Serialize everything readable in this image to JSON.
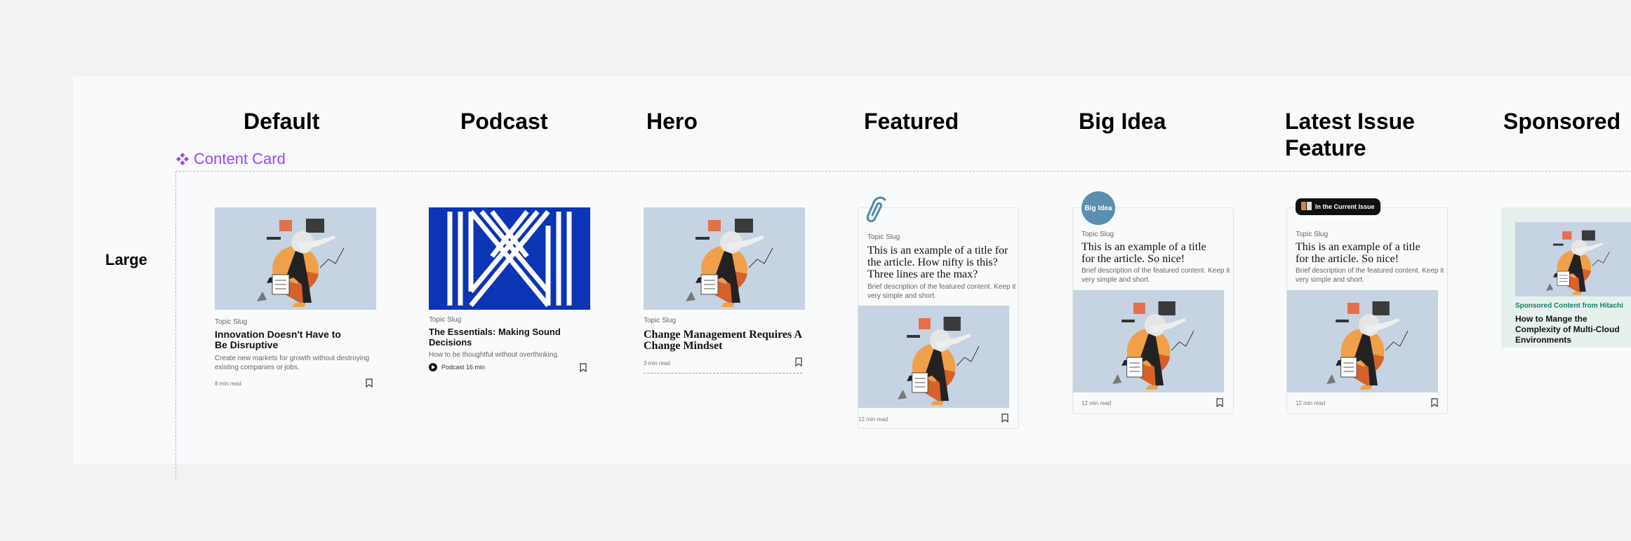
{
  "columns": [
    "Default",
    "Podcast",
    "Hero",
    "Featured",
    "Big Idea",
    "Latest Issue Feature",
    "Sponsored"
  ],
  "row_label": "Large",
  "component_label": "Content Card",
  "cards": {
    "default": {
      "slug": "Topic Slug",
      "title": "Innovation Doesn't Have to Be Disruptive",
      "description": "Create new markets for growth without destroying existing companies or jobs.",
      "meta": "8 min read"
    },
    "podcast": {
      "slug": "Topic Slug",
      "title": "The Essentials: Making Sound Decisions",
      "description": "How to be thoughtful without overthinking.",
      "meta": "Podcast 16 min"
    },
    "hero": {
      "slug": "Topic Slug",
      "title": "Change Management Requires A Change Mindset",
      "meta": "3 min read"
    },
    "featured": {
      "slug": "Topic Slug",
      "title": "This is an example of a title for the article. How nifty is this? Three lines are the max?",
      "description": "Brief description of the featured content. Keep it very simple and short.",
      "meta": "12 min read"
    },
    "big_idea": {
      "badge": "Big Idea",
      "slug": "Topic Slug",
      "title": "This is an example of a title for the article. So nice!",
      "description": "Brief description of the featured content. Keep it very simple and short.",
      "meta": "12 min read"
    },
    "latest_issue": {
      "badge": "In the Current Issue",
      "slug": "Topic Slug",
      "title": "This is an example of a title for the article. So nice!",
      "description": "Brief description of the featured content. Keep it very simple and short.",
      "meta": "12 min read"
    },
    "sponsored": {
      "label": "Sponsored Content from Hitachi",
      "title": "How to Mange the Complexity of Multi-Cloud Environments"
    }
  },
  "icons": {
    "component": "component-diamond-icon",
    "bookmark": "bookmark-icon",
    "paperclip": "paperclip-icon",
    "play": "play-icon",
    "magazine": "magazine-icon"
  },
  "colors": {
    "component_purple": "#9747ff",
    "thumb_bg": "#c5d3e2",
    "podcast_blue": "#0b35b5",
    "big_idea_badge": "#5c8ead",
    "sponsored_green": "#1b7c6a"
  }
}
